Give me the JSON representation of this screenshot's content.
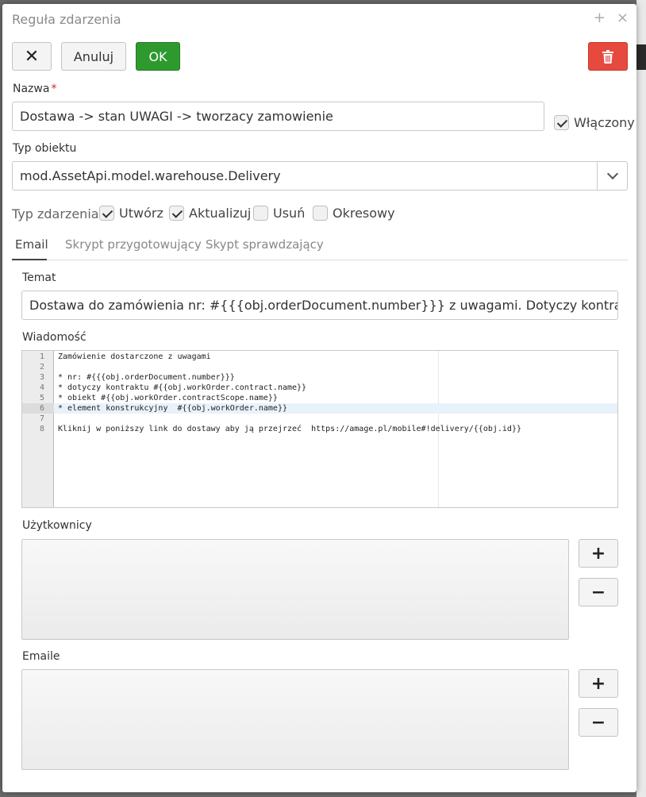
{
  "dialog": {
    "title": "Reguła zdarzenia",
    "title_icons": [
      "plus-icon",
      "close-icon"
    ]
  },
  "toolbar": {
    "close_symbol": "✕",
    "cancel_label": "Anuluj",
    "ok_label": "OK",
    "delete_icon": "trash-icon"
  },
  "form": {
    "name_label": "Nazwa",
    "required_mark": "*",
    "name_value": "Dostawa -> stan UWAGI -> tworzacy zamowienie",
    "enabled_label": "Włączony",
    "enabled_checked": true,
    "object_type_label": "Typ obiektu",
    "object_type_value": "mod.AssetApi.model.warehouse.Delivery",
    "event_type_label": "Typ zdarzenia",
    "event_types": [
      {
        "label": "Utwórz",
        "checked": true
      },
      {
        "label": "Aktualizuj",
        "checked": true
      },
      {
        "label": "Usuń",
        "checked": false
      },
      {
        "label": "Okresowy",
        "checked": false
      }
    ]
  },
  "tabs": [
    {
      "label": "Email",
      "active": true
    },
    {
      "label": "Skrypt przygotowujący",
      "active": false
    },
    {
      "label": "Skypt sprawdzający",
      "active": false
    }
  ],
  "email": {
    "subject_label": "Temat",
    "subject_value": "Dostawa do zamówienia nr: #{{{obj.orderDocument.number}}} z uwagami. Dotyczy kontraktu #{{o",
    "message_label": "Wiadomość",
    "message_lines": [
      {
        "num": "1",
        "text": "Zamówienie dostarczone z uwagami"
      },
      {
        "num": "2",
        "text": ""
      },
      {
        "num": "3",
        "text": "* nr: #{{{obj.orderDocument.number}}}"
      },
      {
        "num": "4",
        "text": "* dotyczy kontraktu #{{obj.workOrder.contract.name}}"
      },
      {
        "num": "5",
        "text": "* obiekt #{{obj.workOrder.contractScope.name}}"
      },
      {
        "num": "6",
        "text": "* element konstrukcyjny  #{{obj.workOrder.name}}"
      },
      {
        "num": "7",
        "text": ""
      },
      {
        "num": "8",
        "text": "Kliknij w poniższy link do dostawy aby ją przejrzeć  https://amage.pl/mobile#!delivery/{{obj.id}}"
      }
    ],
    "highlighted_line": 6,
    "users_label": "Użytkownicy",
    "emails_label": "Emaile",
    "add_symbol": "+",
    "remove_symbol": "−"
  }
}
